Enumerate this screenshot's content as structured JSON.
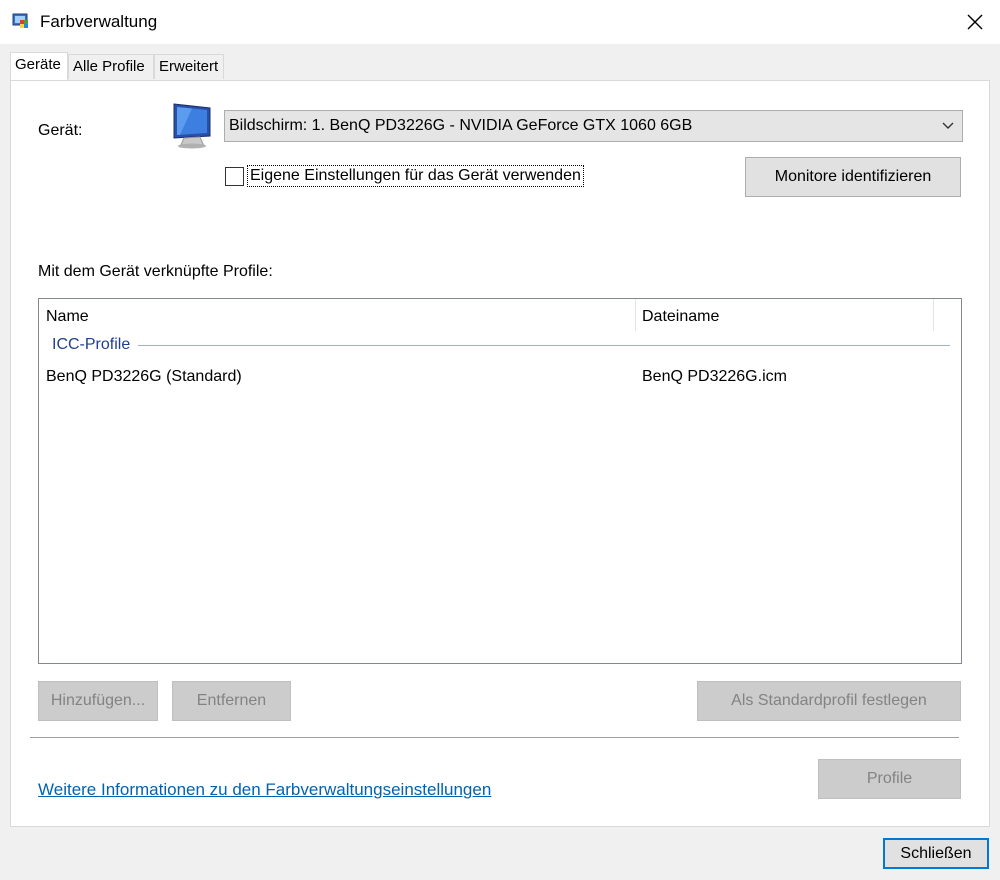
{
  "window": {
    "title": "Farbverwaltung"
  },
  "tabs": [
    {
      "label": "Geräte",
      "active": true
    },
    {
      "label": "Alle Profile",
      "active": false
    },
    {
      "label": "Erweitert",
      "active": false
    }
  ],
  "device": {
    "label": "Gerät:",
    "selected": "Bildschirm: 1. BenQ PD3226G - NVIDIA GeForce GTX 1060 6GB",
    "custom_settings_label": "Eigene Einstellungen für das Gerät verwenden",
    "custom_settings_checked": false,
    "identify_button": "Monitore identifizieren"
  },
  "profiles": {
    "section_label": "Mit dem Gerät verknüpfte Profile:",
    "columns": [
      "Name",
      "Dateiname"
    ],
    "group": "ICC-Profile",
    "rows": [
      {
        "name": "BenQ PD3226G (Standard)",
        "file": "BenQ PD3226G.icm"
      }
    ],
    "add_button": "Hinzufügen...",
    "remove_button": "Entfernen",
    "default_button": "Als Standardprofil festlegen"
  },
  "footer": {
    "link": "Weitere Informationen zu den Farbverwaltungseinstellungen",
    "profile_button": "Profile",
    "close_button": "Schließen"
  },
  "colors": {
    "accent": "#0078d7",
    "link": "#0063b1",
    "group": "#1f3f90"
  }
}
